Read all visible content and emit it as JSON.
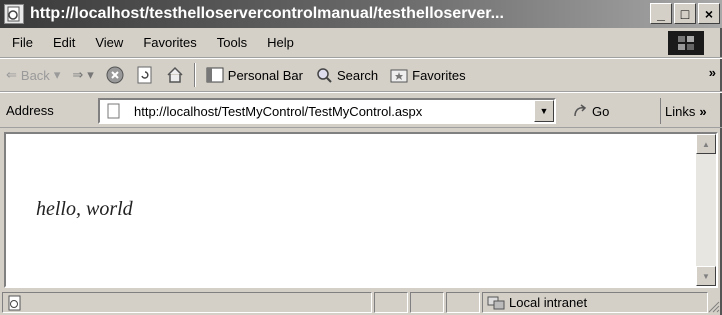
{
  "window": {
    "title": "http://localhost/testhelloservercontrolmanual/testhelloserver...",
    "minimize": "_",
    "maximize": "□",
    "close": "×"
  },
  "menu": {
    "items": [
      "File",
      "Edit",
      "View",
      "Favorites",
      "Tools",
      "Help"
    ]
  },
  "toolbar": {
    "back": "Back",
    "forward_icon": "forward-arrow-icon",
    "stop_icon": "stop-icon",
    "refresh_icon": "refresh-icon",
    "home_icon": "home-icon",
    "personal_bar": "Personal Bar",
    "search": "Search",
    "favorites": "Favorites",
    "more": "»"
  },
  "address": {
    "label": "Address",
    "url": "http://localhost/TestMyControl/TestMyControl.aspx",
    "go": "Go",
    "links": "Links",
    "links_more": "»"
  },
  "content": {
    "text": "hello, world"
  },
  "status": {
    "zone": "Local intranet"
  }
}
